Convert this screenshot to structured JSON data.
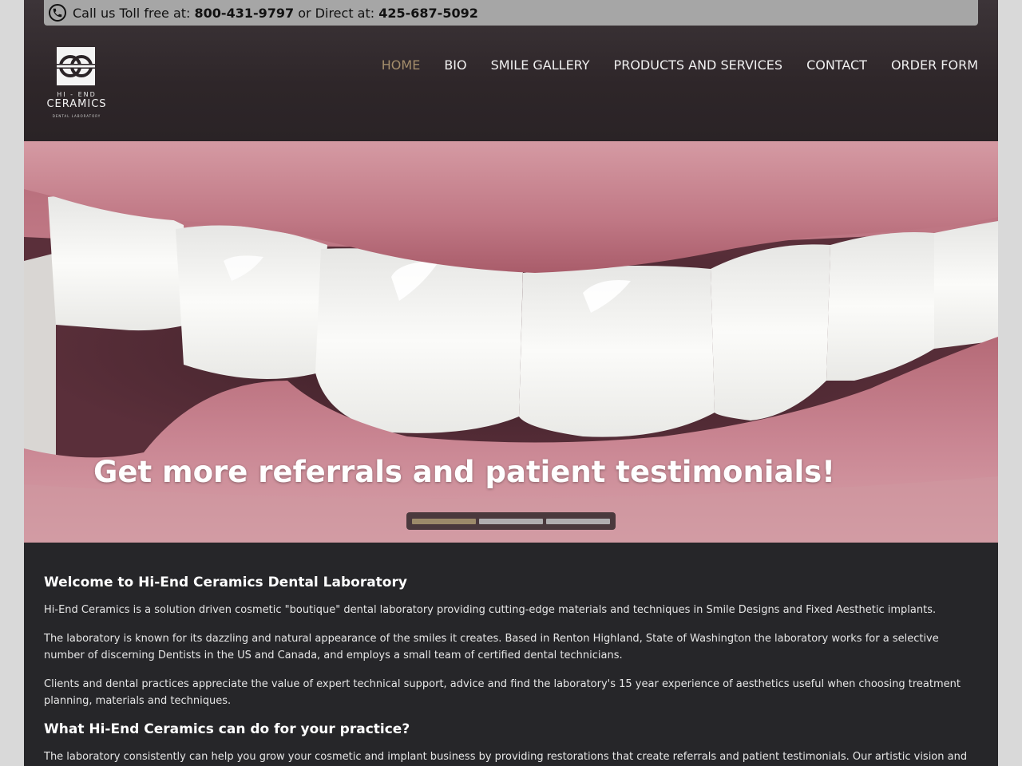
{
  "topbar": {
    "prefix": "Call us Toll free at: ",
    "toll_free": "800-431-9797",
    "middle": " or Direct at: ",
    "direct": "425-687-5092"
  },
  "logo": {
    "line1": "HI - END",
    "line2": "CERAMICS",
    "line3": "DENTAL LABORATORY"
  },
  "nav": {
    "items": [
      {
        "label": "HOME",
        "active": true
      },
      {
        "label": "BIO"
      },
      {
        "label": "SMILE GALLERY"
      },
      {
        "label": "PRODUCTS AND SERVICES"
      },
      {
        "label": "CONTACT"
      },
      {
        "label": "ORDER FORM"
      }
    ]
  },
  "hero": {
    "caption": "Get more referrals and patient testimonials!",
    "slides": 3,
    "active_slide": 1
  },
  "content": {
    "heading1": "Welcome to Hi-End Ceramics Dental Laboratory",
    "para1": "Hi-End Ceramics is a solution driven cosmetic \"boutique\" dental laboratory providing cutting-edge materials and techniques in Smile Designs and Fixed Aesthetic implants.",
    "para2": "The laboratory is known for its dazzling and natural appearance of the smiles it creates. Based in Renton Highland, State of Washington the laboratory works for a selective number of discerning Dentists in the US and Canada, and employs a small team of certified dental technicians.",
    "para3": "Clients and dental practices appreciate the value of expert technical support, advice and find the laboratory's 15 year experience of aesthetics useful when choosing treatment planning, materials and techniques.",
    "heading2": "What Hi-End Ceramics can do for your practice?",
    "para4": "The laboratory consistently can help you grow your cosmetic and implant business by providing restorations that create referrals and patient testimonials. Our artistic vision and knowledge at Hi-End Ceramics"
  },
  "colors": {
    "accent": "#a48d6b",
    "page_bg": "#262629",
    "topbar_bg": "#a6a6a6"
  }
}
